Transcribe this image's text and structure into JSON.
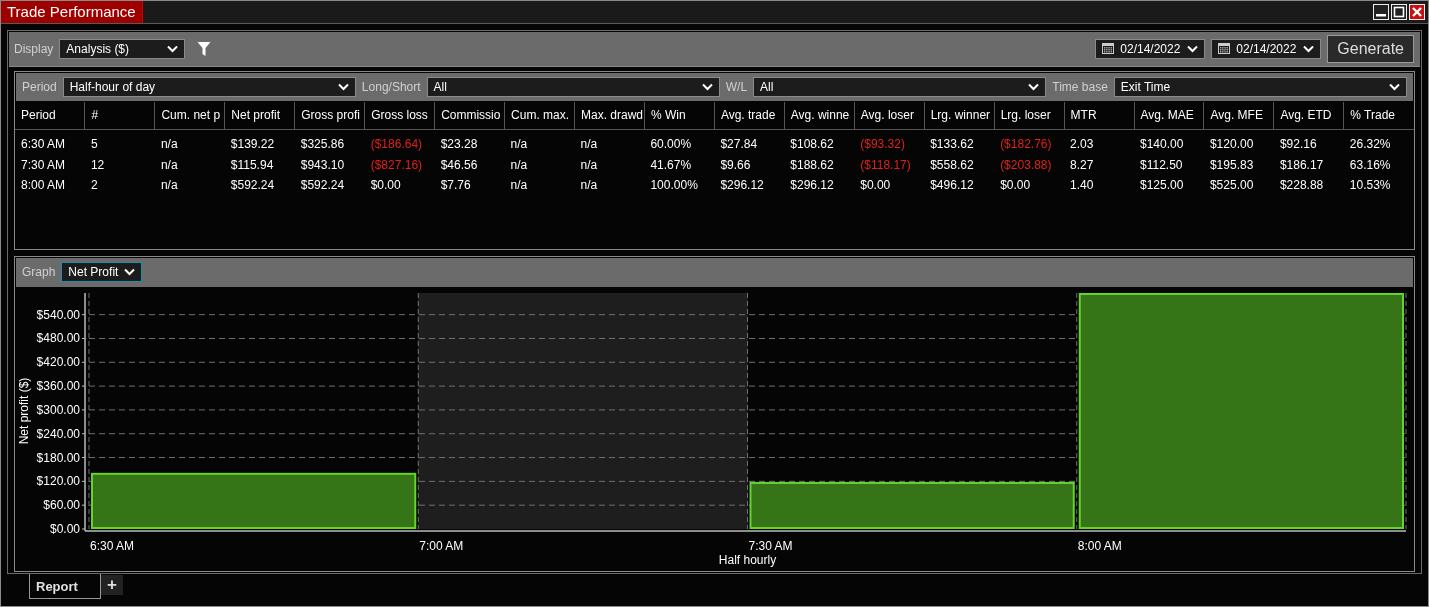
{
  "window": {
    "title": "Trade Performance"
  },
  "toolbar": {
    "display_label": "Display",
    "display_value": "Analysis ($)",
    "date_from": "02/14/2022",
    "date_to": "02/14/2022",
    "generate": "Generate"
  },
  "filters": [
    {
      "label": "Period",
      "value": "Half-hour of day"
    },
    {
      "label": "Long/Short",
      "value": "All"
    },
    {
      "label": "W/L",
      "value": "All"
    },
    {
      "label": "Time base",
      "value": "Exit Time"
    }
  ],
  "table": {
    "columns": [
      "Period",
      "#",
      "Cum. net p",
      "Net profit",
      "Gross profi",
      "Gross loss",
      "Commissio",
      "Cum. max.",
      "Max. drawd",
      "% Win",
      "Avg. trade",
      "Avg. winne",
      "Avg. loser",
      "Lrg. winner",
      "Lrg. loser",
      "MTR",
      "Avg. MAE",
      "Avg. MFE",
      "Avg. ETD",
      "% Trade"
    ],
    "rows": [
      {
        "cells": [
          {
            "text": "6:30 AM",
            "negative": false
          },
          {
            "text": "5",
            "negative": false
          },
          {
            "text": "n/a",
            "negative": false
          },
          {
            "text": "$139.22",
            "negative": false
          },
          {
            "text": "$325.86",
            "negative": false
          },
          {
            "text": "($186.64)",
            "negative": true
          },
          {
            "text": "$23.28",
            "negative": false
          },
          {
            "text": "n/a",
            "negative": false
          },
          {
            "text": "n/a",
            "negative": false
          },
          {
            "text": "60.00%",
            "negative": false
          },
          {
            "text": "$27.84",
            "negative": false
          },
          {
            "text": "$108.62",
            "negative": false
          },
          {
            "text": "($93.32)",
            "negative": true
          },
          {
            "text": "$133.62",
            "negative": false
          },
          {
            "text": "($182.76)",
            "negative": true
          },
          {
            "text": "2.03",
            "negative": false
          },
          {
            "text": "$140.00",
            "negative": false
          },
          {
            "text": "$120.00",
            "negative": false
          },
          {
            "text": "$92.16",
            "negative": false
          },
          {
            "text": "26.32%",
            "negative": false
          }
        ]
      },
      {
        "cells": [
          {
            "text": "7:30 AM",
            "negative": false
          },
          {
            "text": "12",
            "negative": false
          },
          {
            "text": "n/a",
            "negative": false
          },
          {
            "text": "$115.94",
            "negative": false
          },
          {
            "text": "$943.10",
            "negative": false
          },
          {
            "text": "($827.16)",
            "negative": true
          },
          {
            "text": "$46.56",
            "negative": false
          },
          {
            "text": "n/a",
            "negative": false
          },
          {
            "text": "n/a",
            "negative": false
          },
          {
            "text": "41.67%",
            "negative": false
          },
          {
            "text": "$9.66",
            "negative": false
          },
          {
            "text": "$188.62",
            "negative": false
          },
          {
            "text": "($118.17)",
            "negative": true
          },
          {
            "text": "$558.62",
            "negative": false
          },
          {
            "text": "($203.88)",
            "negative": true
          },
          {
            "text": "8.27",
            "negative": false
          },
          {
            "text": "$112.50",
            "negative": false
          },
          {
            "text": "$195.83",
            "negative": false
          },
          {
            "text": "$186.17",
            "negative": false
          },
          {
            "text": "63.16%",
            "negative": false
          }
        ]
      },
      {
        "cells": [
          {
            "text": "8:00 AM",
            "negative": false
          },
          {
            "text": "2",
            "negative": false
          },
          {
            "text": "n/a",
            "negative": false
          },
          {
            "text": "$592.24",
            "negative": false
          },
          {
            "text": "$592.24",
            "negative": false
          },
          {
            "text": "$0.00",
            "negative": false
          },
          {
            "text": "$7.76",
            "negative": false
          },
          {
            "text": "n/a",
            "negative": false
          },
          {
            "text": "n/a",
            "negative": false
          },
          {
            "text": "100.00%",
            "negative": false
          },
          {
            "text": "$296.12",
            "negative": false
          },
          {
            "text": "$296.12",
            "negative": false
          },
          {
            "text": "$0.00",
            "negative": false
          },
          {
            "text": "$496.12",
            "negative": false
          },
          {
            "text": "$0.00",
            "negative": false
          },
          {
            "text": "1.40",
            "negative": false
          },
          {
            "text": "$125.00",
            "negative": false
          },
          {
            "text": "$525.00",
            "negative": false
          },
          {
            "text": "$228.88",
            "negative": false
          },
          {
            "text": "10.53%",
            "negative": false
          }
        ]
      }
    ]
  },
  "graph": {
    "label": "Graph",
    "value": "Net Profit",
    "chart_data": {
      "type": "bar",
      "xlabel": "Half hourly",
      "ylabel": "Net profit ($)",
      "categories": [
        "6:30 AM",
        "7:00 AM",
        "7:30 AM",
        "8:00 AM"
      ],
      "values": [
        139,
        null,
        116,
        592
      ],
      "ylim": [
        0,
        592
      ],
      "grid": true,
      "yticks": [
        {
          "value": 0,
          "label": "$0.00"
        },
        {
          "value": 60,
          "label": "$60.00"
        },
        {
          "value": 120,
          "label": "$120.00"
        },
        {
          "value": 180,
          "label": "$180.00"
        },
        {
          "value": 240,
          "label": "$240.00"
        },
        {
          "value": 300,
          "label": "$300.00"
        },
        {
          "value": 360,
          "label": "$360.00"
        },
        {
          "value": 420,
          "label": "$420.00"
        },
        {
          "value": 480,
          "label": "$480.00"
        },
        {
          "value": 540,
          "label": "$540.00"
        }
      ]
    }
  },
  "tabs": [
    {
      "label": "Report",
      "selected": true
    }
  ],
  "add_tab": "+"
}
